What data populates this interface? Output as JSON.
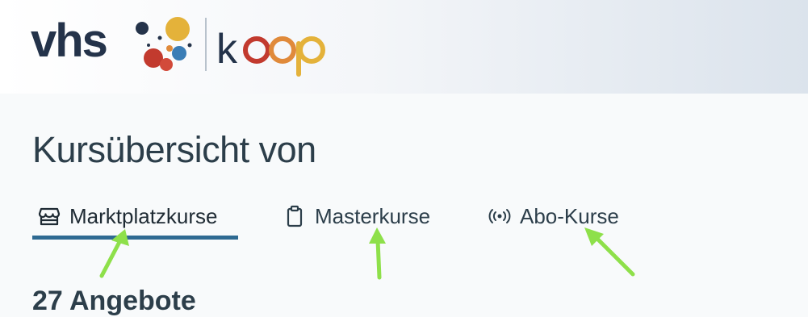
{
  "logo": {
    "brand_text": "vhs",
    "product_text": "koop",
    "colors": {
      "navy": "#24334a",
      "yellow": "#e4b23a",
      "red": "#c23a2e",
      "blue": "#3a7db6",
      "orange": "#e08a3a"
    }
  },
  "header": {
    "page_title": "Kursübersicht von"
  },
  "tabs": [
    {
      "label": "Marktplatzkurse",
      "icon": "store-icon",
      "active": true
    },
    {
      "label": "Masterkurse",
      "icon": "clipboard-icon",
      "active": false
    },
    {
      "label": "Abo-Kurse",
      "icon": "broadcast-icon",
      "active": false
    }
  ],
  "colors": {
    "accent": "#2e6a92",
    "annotation_arrow": "#8ee04a",
    "text": "#2c3e4a"
  },
  "results": {
    "count_text_partial": "27 Angebote"
  }
}
